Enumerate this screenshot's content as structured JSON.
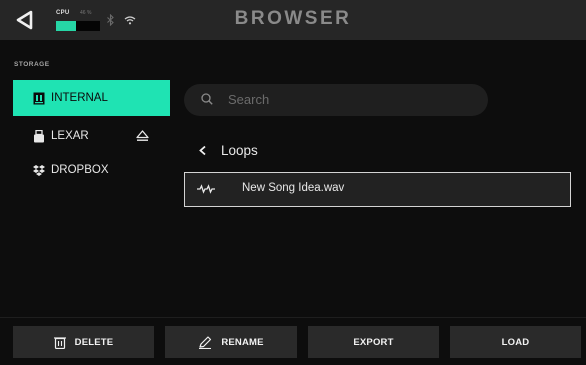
{
  "header": {
    "title": "BROWSER",
    "cpu_label": "CPU",
    "cpu_percent_text": "46 %",
    "cpu_level": 0.46,
    "icons": [
      "back-icon",
      "bluetooth-icon",
      "wifi-icon"
    ]
  },
  "sidebar": {
    "heading": "STORAGE",
    "items": [
      {
        "label": "INTERNAL",
        "icon": "internal-storage-icon",
        "selected": true
      },
      {
        "label": "LEXAR",
        "icon": "usb-drive-icon",
        "selected": false
      },
      {
        "label": "DROPBOX",
        "icon": "dropbox-icon",
        "selected": false
      }
    ],
    "eject_icon": "eject-icon"
  },
  "main": {
    "search_placeholder": "Search",
    "folder_label": "Loops",
    "files": [
      {
        "name": "New Song Idea.wav",
        "icon": "waveform-file-icon",
        "selected": true
      }
    ]
  },
  "actions": {
    "delete_label": "DELETE",
    "rename_label": "RENAME",
    "export_label": "EXPORT",
    "load_label": "LOAD"
  },
  "colors": {
    "accent": "#1fe3b3",
    "cpu_meter": "#26d6a6",
    "background": "#0d0d0d",
    "header": "#262626",
    "button": "#2a2a2a"
  }
}
